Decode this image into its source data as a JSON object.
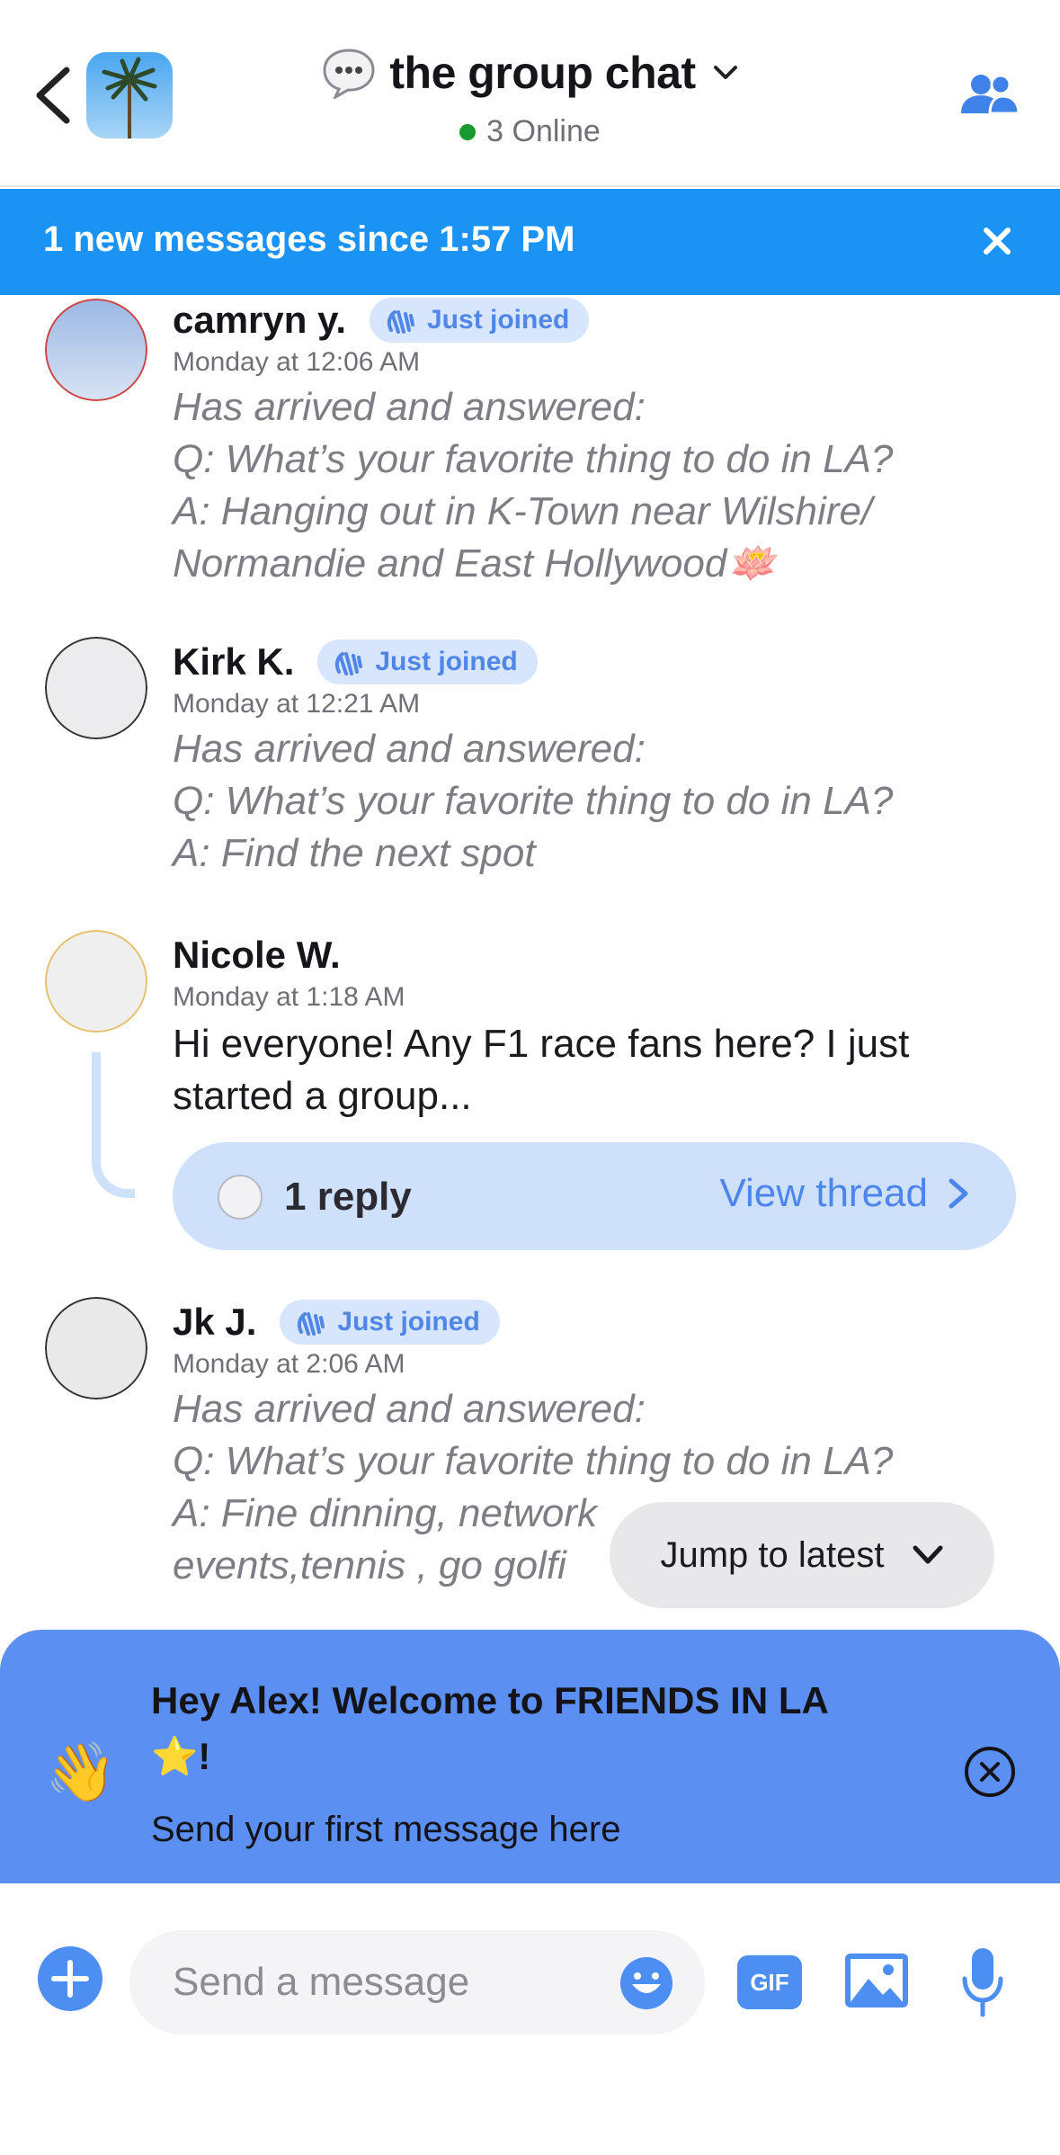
{
  "header": {
    "title_emoji": "💬",
    "title": "the group chat",
    "online": "3 Online",
    "accent": "#4c8ef2"
  },
  "banner": {
    "text": "1 new messages since 1:57 PM",
    "color": "#1a93f5"
  },
  "messages": [
    {
      "name": "camryn y.",
      "badge": "Just joined",
      "time": "Monday at 12:06 AM",
      "lines": [
        "Has arrived and answered:",
        "Q: What’s your favorite thing to do in LA?",
        "A: Hanging out in K-Town near Wilshire/",
        "Normandie and East Hollywood🪷"
      ]
    },
    {
      "name": "Kirk K.",
      "badge": "Just joined",
      "time": "Monday at 12:21 AM",
      "lines": [
        "Has arrived and answered:",
        "Q: What’s your favorite thing to do in LA?",
        "A: Find the next spot"
      ]
    },
    {
      "name": "Nicole W.",
      "time": "Monday at 1:18 AM",
      "lines": [
        "Hi everyone!  Any F1 race fans here?  I just",
        "started a group..."
      ],
      "thread": {
        "count": "1 reply",
        "view": "View thread"
      }
    },
    {
      "name": "Jk J.",
      "badge": "Just joined",
      "time": "Monday at 2:06 AM",
      "lines": [
        "Has arrived and answered:",
        "Q: What’s your favorite thing to do in LA?",
        "A: Fine dinning, network",
        "events,tennis , go golfi"
      ]
    }
  ],
  "jump": {
    "label": "Jump to latest"
  },
  "welcome": {
    "emoji": "👋",
    "title_line1": "Hey Alex! Welcome to FRIENDS IN LA",
    "title_line2": "⭐!",
    "subtitle": "Send your first message here",
    "color": "#5b8ff1"
  },
  "composer": {
    "placeholder": "Send a message",
    "gif_label": "GIF"
  }
}
